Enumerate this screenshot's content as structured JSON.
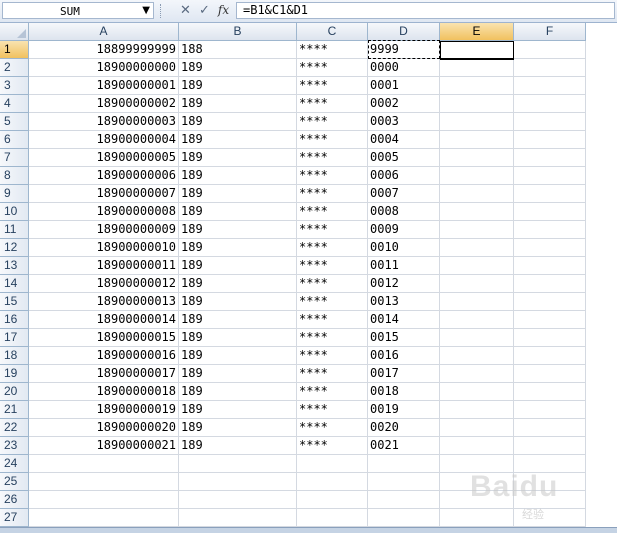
{
  "formula_bar": {
    "name_box": "SUM",
    "formula": "=B1&C1&D1",
    "cancel_icon": "✕",
    "enter_icon": "✓",
    "fx_label": "fx",
    "dropdown_icon": "▼"
  },
  "columns": [
    "A",
    "B",
    "C",
    "D",
    "E",
    "F"
  ],
  "active_column": "E",
  "active_row": 1,
  "rows": [
    {
      "n": "1",
      "a": "18899999999",
      "b": "188",
      "c": "****",
      "d": "9999",
      "e": "=B1&C1&D1"
    },
    {
      "n": "2",
      "a": "18900000000",
      "b": "189",
      "c": "****",
      "d": "0000",
      "e": ""
    },
    {
      "n": "3",
      "a": "18900000001",
      "b": "189",
      "c": "****",
      "d": "0001",
      "e": ""
    },
    {
      "n": "4",
      "a": "18900000002",
      "b": "189",
      "c": "****",
      "d": "0002",
      "e": ""
    },
    {
      "n": "5",
      "a": "18900000003",
      "b": "189",
      "c": "****",
      "d": "0003",
      "e": ""
    },
    {
      "n": "6",
      "a": "18900000004",
      "b": "189",
      "c": "****",
      "d": "0004",
      "e": ""
    },
    {
      "n": "7",
      "a": "18900000005",
      "b": "189",
      "c": "****",
      "d": "0005",
      "e": ""
    },
    {
      "n": "8",
      "a": "18900000006",
      "b": "189",
      "c": "****",
      "d": "0006",
      "e": ""
    },
    {
      "n": "9",
      "a": "18900000007",
      "b": "189",
      "c": "****",
      "d": "0007",
      "e": ""
    },
    {
      "n": "10",
      "a": "18900000008",
      "b": "189",
      "c": "****",
      "d": "0008",
      "e": ""
    },
    {
      "n": "11",
      "a": "18900000009",
      "b": "189",
      "c": "****",
      "d": "0009",
      "e": ""
    },
    {
      "n": "12",
      "a": "18900000010",
      "b": "189",
      "c": "****",
      "d": "0010",
      "e": ""
    },
    {
      "n": "13",
      "a": "18900000011",
      "b": "189",
      "c": "****",
      "d": "0011",
      "e": ""
    },
    {
      "n": "14",
      "a": "18900000012",
      "b": "189",
      "c": "****",
      "d": "0012",
      "e": ""
    },
    {
      "n": "15",
      "a": "18900000013",
      "b": "189",
      "c": "****",
      "d": "0013",
      "e": ""
    },
    {
      "n": "16",
      "a": "18900000014",
      "b": "189",
      "c": "****",
      "d": "0014",
      "e": ""
    },
    {
      "n": "17",
      "a": "18900000015",
      "b": "189",
      "c": "****",
      "d": "0015",
      "e": ""
    },
    {
      "n": "18",
      "a": "18900000016",
      "b": "189",
      "c": "****",
      "d": "0016",
      "e": ""
    },
    {
      "n": "19",
      "a": "18900000017",
      "b": "189",
      "c": "****",
      "d": "0017",
      "e": ""
    },
    {
      "n": "20",
      "a": "18900000018",
      "b": "189",
      "c": "****",
      "d": "0018",
      "e": ""
    },
    {
      "n": "21",
      "a": "18900000019",
      "b": "189",
      "c": "****",
      "d": "0019",
      "e": ""
    },
    {
      "n": "22",
      "a": "18900000020",
      "b": "189",
      "c": "****",
      "d": "0020",
      "e": ""
    },
    {
      "n": "23",
      "a": "18900000021",
      "b": "189",
      "c": "****",
      "d": "0021",
      "e": ""
    },
    {
      "n": "24",
      "a": "",
      "b": "",
      "c": "",
      "d": "",
      "e": ""
    },
    {
      "n": "25",
      "a": "",
      "b": "",
      "c": "",
      "d": "",
      "e": ""
    },
    {
      "n": "26",
      "a": "",
      "b": "",
      "c": "",
      "d": "",
      "e": ""
    },
    {
      "n": "27",
      "a": "",
      "b": "",
      "c": "",
      "d": "",
      "e": ""
    }
  ],
  "watermark": {
    "main": "Baidu",
    "sub": "经验"
  },
  "colors": {
    "header_active": "#f1c15f",
    "gridline": "#d4d9e1",
    "header_border": "#9eb6ce"
  }
}
